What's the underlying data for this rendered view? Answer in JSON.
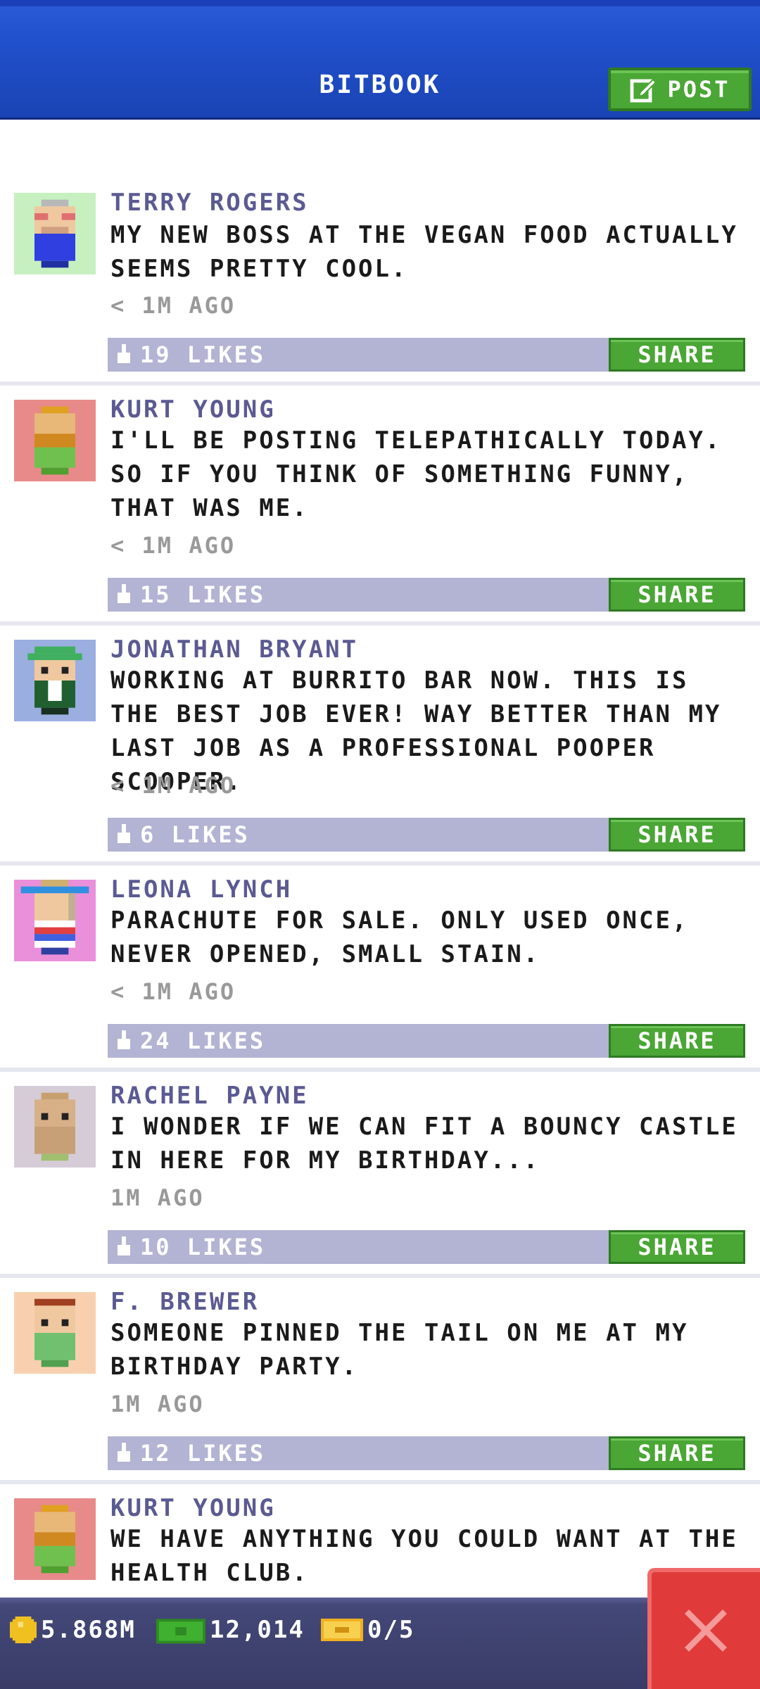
{
  "header": {
    "title": "BITBOOK",
    "post_label": "POST"
  },
  "posts": [
    {
      "author": "TERRY ROGERS",
      "text": "MY NEW BOSS AT THE VEGAN FOOD ACTUALLY SEEMS PRETTY COOL.",
      "time": "< 1M AGO",
      "likes": "19 LIKES",
      "share": "SHARE",
      "avatar_bg": "#c6f0c0"
    },
    {
      "author": "KURT YOUNG",
      "text": "I'LL BE POSTING TELEPATHICALLY TODAY. SO IF YOU THINK OF SOMETHING FUNNY, THAT WAS ME.",
      "time": "< 1M AGO",
      "likes": "15 LIKES",
      "share": "SHARE",
      "avatar_bg": "#e88a8a"
    },
    {
      "author": "JONATHAN BRYANT",
      "text": "WORKING AT BURRITO BAR NOW. THIS IS THE BEST JOB EVER! WAY BETTER THAN MY LAST JOB AS A PROFESSIONAL POOPER SCOOPER.",
      "time": "< 1M AGO",
      "likes": "6 LIKES",
      "share": "SHARE",
      "avatar_bg": "#9aaee0"
    },
    {
      "author": "LEONA LYNCH",
      "text": "PARACHUTE FOR SALE. ONLY USED ONCE, NEVER OPENED, SMALL STAIN.",
      "time": "< 1M AGO",
      "likes": "24 LIKES",
      "share": "SHARE",
      "avatar_bg": "#ea90da"
    },
    {
      "author": "RACHEL PAYNE",
      "text": "I WONDER IF WE CAN FIT A BOUNCY CASTLE IN HERE FOR MY BIRTHDAY...",
      "time": "1M AGO",
      "likes": "10 LIKES",
      "share": "SHARE",
      "avatar_bg": "#d6ccd8"
    },
    {
      "author": "F. BREWER",
      "text": "SOMEONE PINNED THE TAIL ON ME AT MY BIRTHDAY PARTY.",
      "time": "1M AGO",
      "likes": "12 LIKES",
      "share": "SHARE",
      "avatar_bg": "#f8d0b0"
    },
    {
      "author": "KURT YOUNG",
      "text": "WE HAVE ANYTHING YOU COULD WANT AT THE HEALTH CLUB.",
      "time": "",
      "likes": "",
      "share": "",
      "avatar_bg": "#e88a8a"
    }
  ],
  "footer": {
    "coins": "5.868M",
    "bux": "12,014",
    "tickets": "0/5"
  },
  "colors": {
    "header_blue": "#2150cc",
    "green": "#4aa635",
    "like_bar": "#b3b3d4",
    "author": "#5b5a92",
    "close_red": "#e03a3a"
  },
  "icons": {
    "post": "edit-icon",
    "like": "thumbs-up-icon",
    "coin": "coin-icon",
    "bux": "bux-icon",
    "ticket": "ticket-icon",
    "close": "close-icon"
  }
}
